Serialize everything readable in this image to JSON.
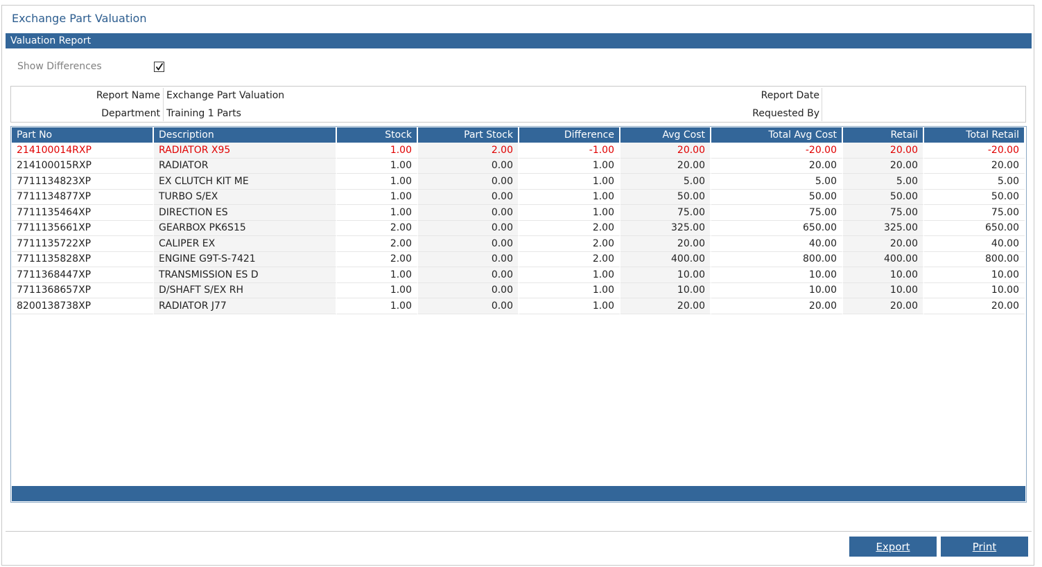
{
  "window": {
    "title": "Exchange Part Valuation"
  },
  "section": {
    "title": "Valuation Report"
  },
  "filters": {
    "show_differences_label": "Show Differences",
    "show_differences_checked": true
  },
  "report_info": {
    "report_name_label": "Report Name",
    "report_name": "Exchange Part Valuation",
    "department_label": "Department",
    "department": "Training 1 Parts",
    "report_date_label": "Report Date",
    "report_date": "",
    "requested_by_label": "Requested By",
    "requested_by": ""
  },
  "table": {
    "columns": [
      "Part No",
      "Description",
      "Stock",
      "Part Stock",
      "Difference",
      "Avg Cost",
      "Total Avg Cost",
      "Retail",
      "Total Retail"
    ],
    "rows": [
      {
        "part_no": "214100014RXP",
        "description": "RADIATOR X95",
        "stock": "1.00",
        "part_stock": "2.00",
        "difference": "-1.00",
        "avg_cost": "20.00",
        "total_avg_cost": "-20.00",
        "retail": "20.00",
        "total_retail": "-20.00",
        "highlight": true
      },
      {
        "part_no": "214100015RXP",
        "description": "RADIATOR",
        "stock": "1.00",
        "part_stock": "0.00",
        "difference": "1.00",
        "avg_cost": "20.00",
        "total_avg_cost": "20.00",
        "retail": "20.00",
        "total_retail": "20.00",
        "highlight": false
      },
      {
        "part_no": "7711134823XP",
        "description": "EX CLUTCH KIT ME",
        "stock": "1.00",
        "part_stock": "0.00",
        "difference": "1.00",
        "avg_cost": "5.00",
        "total_avg_cost": "5.00",
        "retail": "5.00",
        "total_retail": "5.00",
        "highlight": false
      },
      {
        "part_no": "7711134877XP",
        "description": "TURBO S/EX",
        "stock": "1.00",
        "part_stock": "0.00",
        "difference": "1.00",
        "avg_cost": "50.00",
        "total_avg_cost": "50.00",
        "retail": "50.00",
        "total_retail": "50.00",
        "highlight": false
      },
      {
        "part_no": "7711135464XP",
        "description": "DIRECTION ES",
        "stock": "1.00",
        "part_stock": "0.00",
        "difference": "1.00",
        "avg_cost": "75.00",
        "total_avg_cost": "75.00",
        "retail": "75.00",
        "total_retail": "75.00",
        "highlight": false
      },
      {
        "part_no": "7711135661XP",
        "description": "GEARBOX PK6S15",
        "stock": "2.00",
        "part_stock": "0.00",
        "difference": "2.00",
        "avg_cost": "325.00",
        "total_avg_cost": "650.00",
        "retail": "325.00",
        "total_retail": "650.00",
        "highlight": false
      },
      {
        "part_no": "7711135722XP",
        "description": "CALIPER EX",
        "stock": "2.00",
        "part_stock": "0.00",
        "difference": "2.00",
        "avg_cost": "20.00",
        "total_avg_cost": "40.00",
        "retail": "20.00",
        "total_retail": "40.00",
        "highlight": false
      },
      {
        "part_no": "7711135828XP",
        "description": "ENGINE G9T-S-7421",
        "stock": "2.00",
        "part_stock": "0.00",
        "difference": "2.00",
        "avg_cost": "400.00",
        "total_avg_cost": "800.00",
        "retail": "400.00",
        "total_retail": "800.00",
        "highlight": false
      },
      {
        "part_no": "7711368447XP",
        "description": "TRANSMISSION ES D",
        "stock": "1.00",
        "part_stock": "0.00",
        "difference": "1.00",
        "avg_cost": "10.00",
        "total_avg_cost": "10.00",
        "retail": "10.00",
        "total_retail": "10.00",
        "highlight": false
      },
      {
        "part_no": "7711368657XP",
        "description": "D/SHAFT S/EX RH",
        "stock": "1.00",
        "part_stock": "0.00",
        "difference": "1.00",
        "avg_cost": "10.00",
        "total_avg_cost": "10.00",
        "retail": "10.00",
        "total_retail": "10.00",
        "highlight": false
      },
      {
        "part_no": "8200138738XP",
        "description": "RADIATOR J77",
        "stock": "1.00",
        "part_stock": "0.00",
        "difference": "1.00",
        "avg_cost": "20.00",
        "total_avg_cost": "20.00",
        "retail": "20.00",
        "total_retail": "20.00",
        "highlight": false
      }
    ]
  },
  "buttons": {
    "export_label": "Export",
    "print_label": "Print"
  },
  "colors": {
    "accent": "#336699",
    "title": "#2c5d8f",
    "highlight_text": "#e00000"
  },
  "icons": {
    "checkbox": "checkmark-icon"
  }
}
